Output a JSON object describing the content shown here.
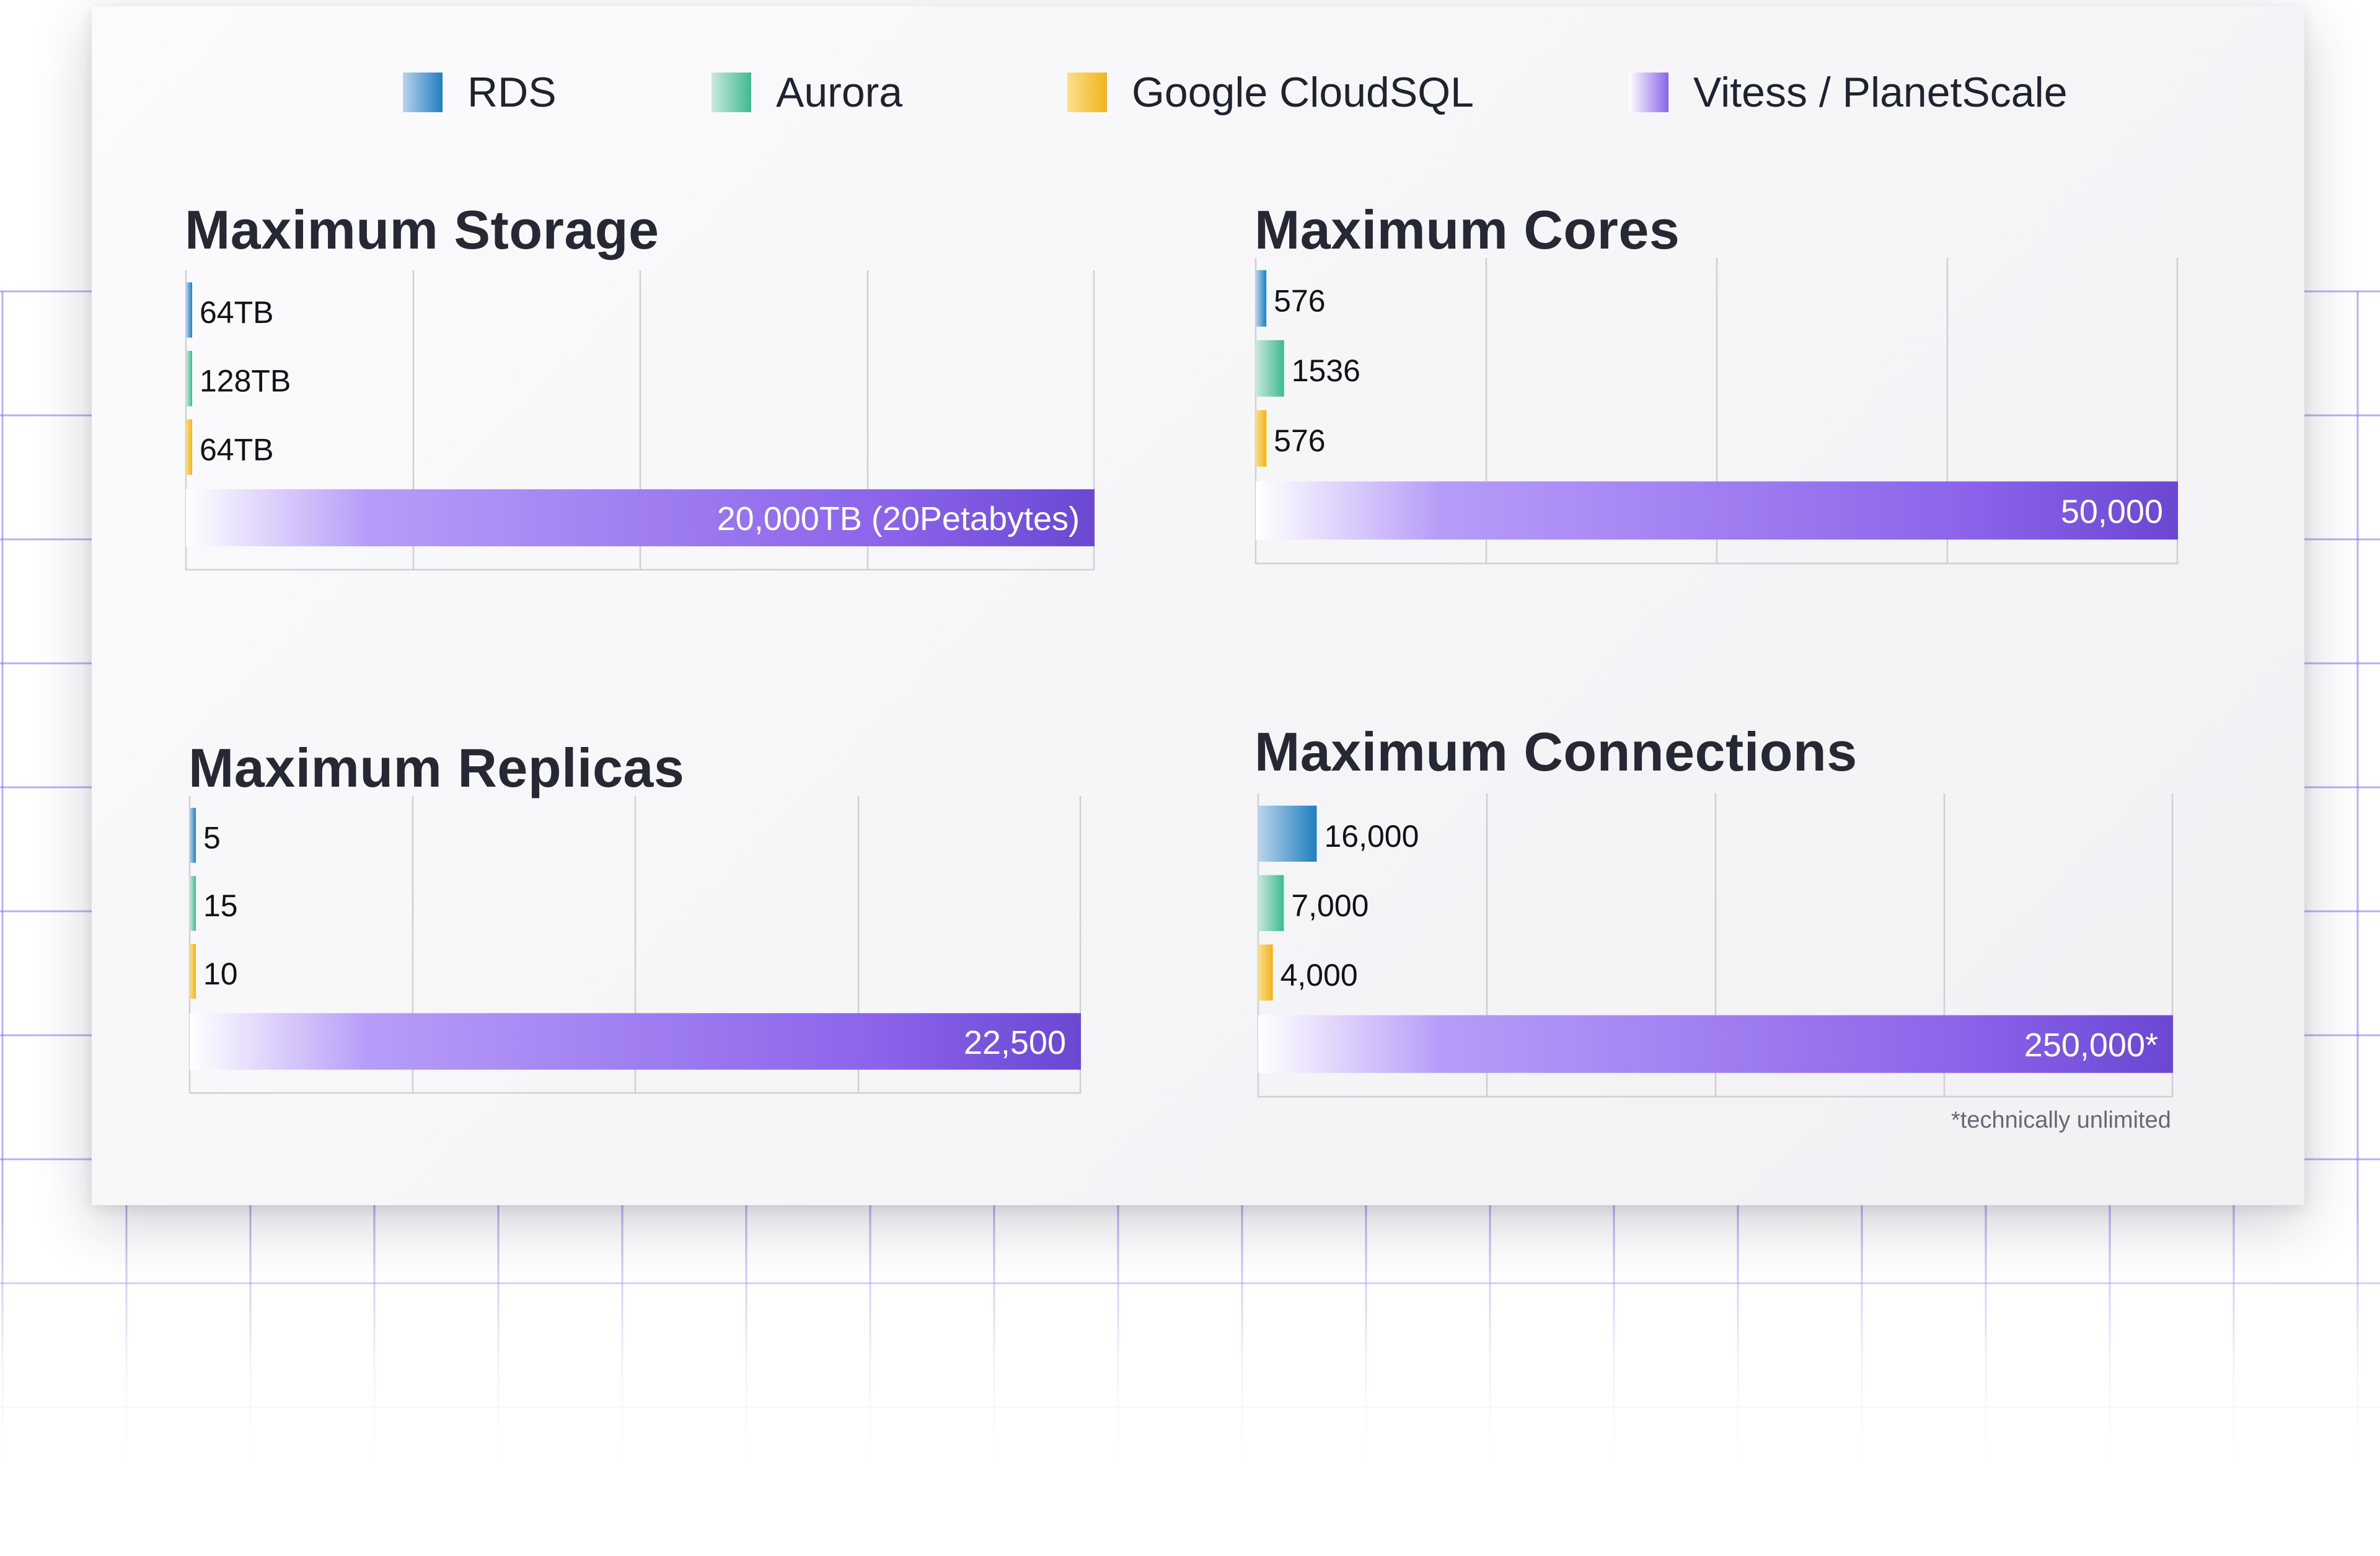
{
  "colors": {
    "rds": [
      "#b9d3ec",
      "#1f7fc0"
    ],
    "aurora": [
      "#c9e9dc",
      "#3dbb8e"
    ],
    "cloudsql": [
      "#fbe08a",
      "#f2b21c"
    ],
    "vitess": [
      "#ffffff",
      "#b79cf8",
      "#8a63ea",
      "#6b47d2"
    ],
    "grid_line": "#cfd0d6",
    "bg_grid": "#8b6be6"
  },
  "legend": {
    "items": [
      {
        "label": "RDS",
        "swatch": "rds"
      },
      {
        "label": "Aurora",
        "swatch": "aurora"
      },
      {
        "label": "Google CloudSQL",
        "swatch": "cloudsql"
      },
      {
        "label": "Vitess / PlanetScale",
        "swatch": "vitess"
      }
    ]
  },
  "footnote": "*technically unlimited",
  "chart_data": [
    {
      "type": "bar",
      "orientation": "horizontal",
      "title": "Maximum Storage",
      "categories": [
        "RDS",
        "Aurora",
        "Google CloudSQL",
        "Vitess / PlanetScale"
      ],
      "values": [
        64,
        128,
        64,
        20000
      ],
      "labels": [
        "64TB",
        "128TB",
        "64TB",
        "20,000TB (20Petabytes)"
      ],
      "xlim": [
        0,
        20000
      ],
      "grid": true
    },
    {
      "type": "bar",
      "orientation": "horizontal",
      "title": "Maximum Cores",
      "categories": [
        "RDS",
        "Aurora",
        "Google CloudSQL",
        "Vitess / PlanetScale"
      ],
      "values": [
        576,
        1536,
        576,
        50000
      ],
      "labels": [
        "576",
        "1536",
        "576",
        "50,000"
      ],
      "xlim": [
        0,
        50000
      ],
      "grid": true
    },
    {
      "type": "bar",
      "orientation": "horizontal",
      "title": "Maximum Replicas",
      "categories": [
        "RDS",
        "Aurora",
        "Google CloudSQL",
        "Vitess / PlanetScale"
      ],
      "values": [
        5,
        15,
        10,
        22500
      ],
      "labels": [
        "5",
        "15",
        "10",
        "22,500"
      ],
      "xlim": [
        0,
        22500
      ],
      "grid": true
    },
    {
      "type": "bar",
      "orientation": "horizontal",
      "title": "Maximum Connections",
      "categories": [
        "RDS",
        "Aurora",
        "Google CloudSQL",
        "Vitess / PlanetScale"
      ],
      "values": [
        16000,
        7000,
        4000,
        250000
      ],
      "labels": [
        "16,000",
        "7,000",
        "4,000",
        "250,000*"
      ],
      "xlim": [
        0,
        250000
      ],
      "grid": true
    }
  ]
}
